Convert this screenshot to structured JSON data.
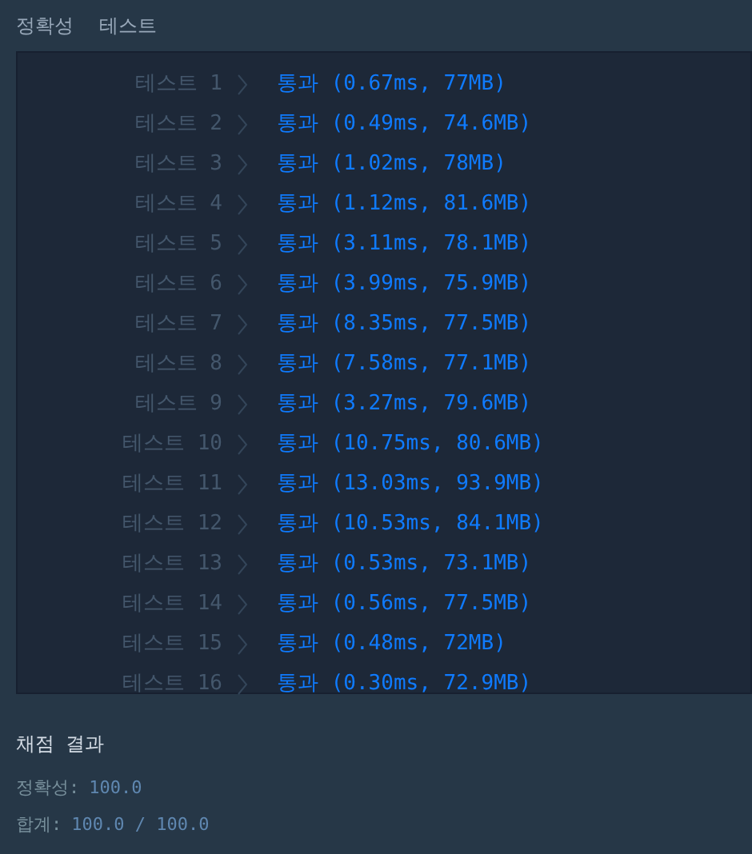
{
  "tabs": [
    {
      "label": "정확성",
      "selected": false
    },
    {
      "label": "테스트",
      "selected": false
    }
  ],
  "tests": [
    {
      "label": "테스트 1",
      "result": "통과 (0.67ms, 77MB)"
    },
    {
      "label": "테스트 2",
      "result": "통과 (0.49ms, 74.6MB)"
    },
    {
      "label": "테스트 3",
      "result": "통과 (1.02ms, 78MB)"
    },
    {
      "label": "테스트 4",
      "result": "통과 (1.12ms, 81.6MB)"
    },
    {
      "label": "테스트 5",
      "result": "통과 (3.11ms, 78.1MB)"
    },
    {
      "label": "테스트 6",
      "result": "통과 (3.99ms, 75.9MB)"
    },
    {
      "label": "테스트 7",
      "result": "통과 (8.35ms, 77.5MB)"
    },
    {
      "label": "테스트 8",
      "result": "통과 (7.58ms, 77.1MB)"
    },
    {
      "label": "테스트 9",
      "result": "통과 (3.27ms, 79.6MB)"
    },
    {
      "label": "테스트 10",
      "result": "통과 (10.75ms, 80.6MB)"
    },
    {
      "label": "테스트 11",
      "result": "통과 (13.03ms, 93.9MB)"
    },
    {
      "label": "테스트 12",
      "result": "통과 (10.53ms, 84.1MB)"
    },
    {
      "label": "테스트 13",
      "result": "통과 (0.53ms, 73.1MB)"
    },
    {
      "label": "테스트 14",
      "result": "통과 (0.56ms, 77.5MB)"
    },
    {
      "label": "테스트 15",
      "result": "통과 (0.48ms, 72MB)"
    },
    {
      "label": "테스트 16",
      "result": "통과 (0.30ms, 72.9MB)"
    }
  ],
  "summary": {
    "title": "채점 결과",
    "lines": [
      {
        "label": "정확성:",
        "value": "100.0"
      },
      {
        "label": "합계:",
        "value": "100.0 / 100.0"
      }
    ]
  }
}
